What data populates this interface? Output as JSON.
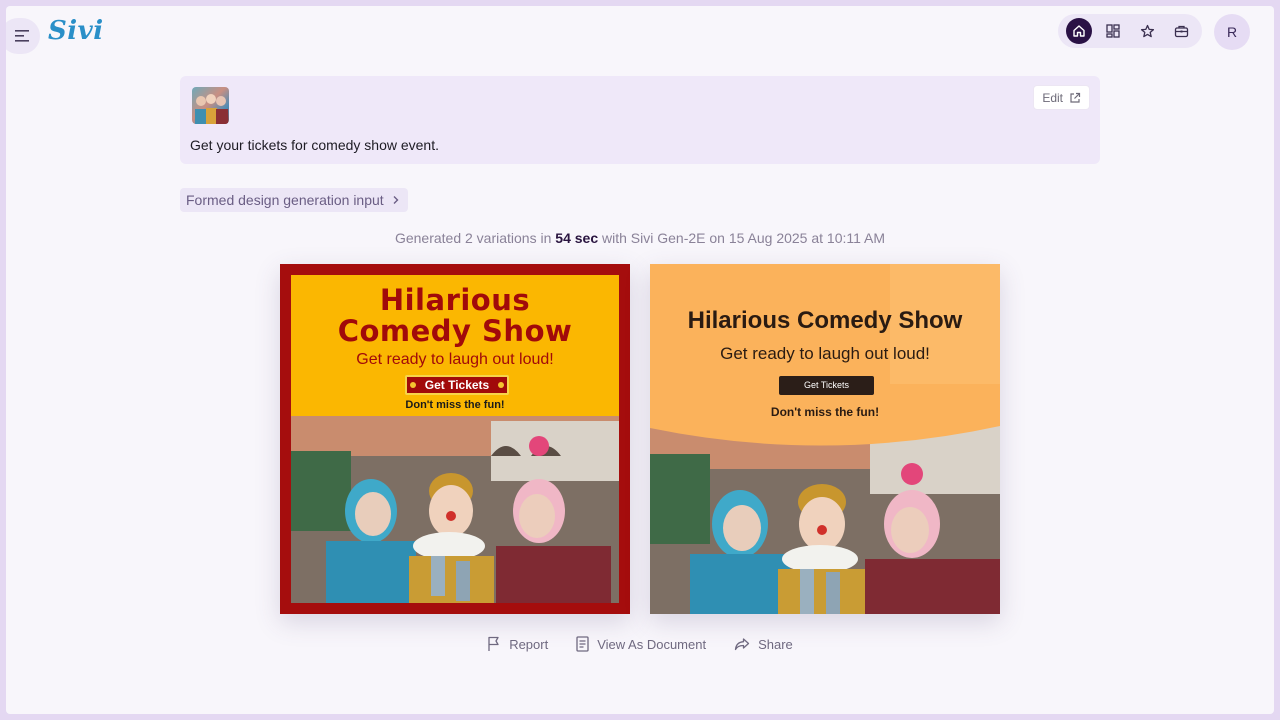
{
  "app": {
    "logo": "Sivi",
    "avatar_initial": "R"
  },
  "nav": {
    "icons": [
      "home-icon",
      "templates-icon",
      "star-icon",
      "briefcase-icon"
    ],
    "active": "home-icon"
  },
  "prompt": {
    "text": "Get your tickets for comedy show event.",
    "edit_label": "Edit"
  },
  "formed_input": {
    "label": "Formed design generation input"
  },
  "generation": {
    "prefix": "Generated 2 variations in",
    "duration": "54 sec",
    "suffix": "with Sivi Gen-2E on 15 Aug 2025 at 10:11 AM"
  },
  "designs": [
    {
      "headline_line1": "Hilarious",
      "headline_line2": "Comedy Show",
      "subheadline": "Get ready to laugh out loud!",
      "button": "Get Tickets",
      "note": "Don't miss the fun!"
    },
    {
      "headline": "Hilarious Comedy Show",
      "subheadline": "Get ready to laugh out loud!",
      "button": "Get Tickets",
      "note": "Don't miss the fun!"
    }
  ],
  "actions": {
    "report": "Report",
    "view_document": "View As Document",
    "share": "Share"
  },
  "colors": {
    "accent": "#2a1145",
    "panel": "#efe8f9",
    "design1_border": "#a50d0d",
    "design1_band": "#fbb701",
    "design2_bg": "#fbb25b"
  }
}
